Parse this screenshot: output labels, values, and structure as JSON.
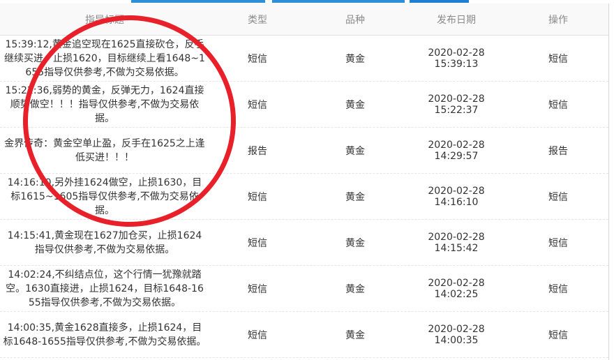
{
  "table": {
    "headers": {
      "title": "指导标题",
      "type": "类型",
      "kind": "品种",
      "date": "发布日期",
      "op": "操作"
    },
    "rows": [
      {
        "title": "15:39:12,黄金追空现在1625直接砍仓，反手继续买进，止损1620，目标继续上看1648~1655指导仅供参考,不做为交易依据。",
        "type": "短信",
        "kind": "黄金",
        "date": "2020-02-28 15:39:13",
        "op": "短信"
      },
      {
        "title": "15:22:36,弱势的黄金，反弹无力，1624直接顺势做空！！！指导仅供参考,不做为交易依据。",
        "type": "短信",
        "kind": "黄金",
        "date": "2020-02-28 15:22:37",
        "op": "短信"
      },
      {
        "title": "金界传奇：黄金空单止盈，反手在1625之上逢低买进！！！",
        "type": "报告",
        "kind": "黄金",
        "date": "2020-02-28 14:29:57",
        "op": "报告"
      },
      {
        "title": "14:16:10,另外挂1624做空，止损1630，目标1615~1605指导仅供参考,不做为交易依据。",
        "type": "短信",
        "kind": "黄金",
        "date": "2020-02-28 14:16:10",
        "op": "短信"
      },
      {
        "title": "14:15:41,黄金现在1627加仓买，止损1624指导仅供参考,不做为交易依据。",
        "type": "短信",
        "kind": "黄金",
        "date": "2020-02-28 14:15:42",
        "op": "短信"
      },
      {
        "title": "14:02:24,不纠结点位，这个行情一犹豫就踏空。1630直接进，止损1624，目标1648-1655指导仅供参考,不做为交易依据。",
        "type": "短信",
        "kind": "黄金",
        "date": "2020-02-28 14:02:25",
        "op": "短信"
      },
      {
        "title": "14:00:35,黄金1628直接多，止损1624，目标1648-1655指导仅供参考,不做为交易依据。",
        "type": "短信",
        "kind": "黄金",
        "date": "2020-02-28 14:00:35",
        "op": "短信"
      }
    ]
  },
  "colors": {
    "accent_tab": "#2f8fd8",
    "annotation_circle": "#e8202a",
    "header_text": "#8a8a8a"
  }
}
